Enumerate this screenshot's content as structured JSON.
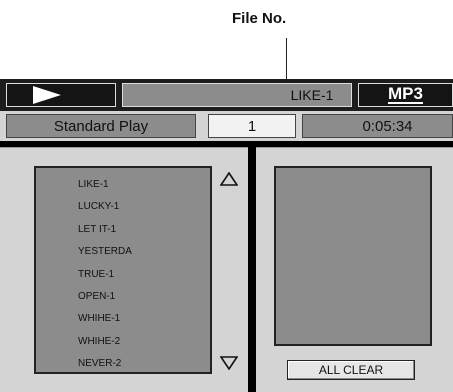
{
  "callout": {
    "label": "File No."
  },
  "player": {
    "play_icon": "play-icon",
    "track_title": "LIKE-1",
    "format_logo": "MP3",
    "mode": "Standard Play",
    "file_number": "1",
    "elapsed_time": "0:05:34"
  },
  "file_list": {
    "items": [
      "LIKE-1",
      "LUCKY-1",
      "LET IT-1",
      "YESTERDA",
      "TRUE-1",
      "OPEN-1",
      "WHIHE-1",
      "WHIHE-2",
      "NEVER-2"
    ],
    "scroll_up_icon": "triangle-up-icon",
    "scroll_down_icon": "triangle-down-icon"
  },
  "buttons": {
    "all_clear": "ALL CLEAR"
  },
  "colors": {
    "panel_gray": "#d4d4d4",
    "field_gray": "#8c8c8c",
    "dark": "#141414",
    "white_field": "#f2f2f2"
  }
}
